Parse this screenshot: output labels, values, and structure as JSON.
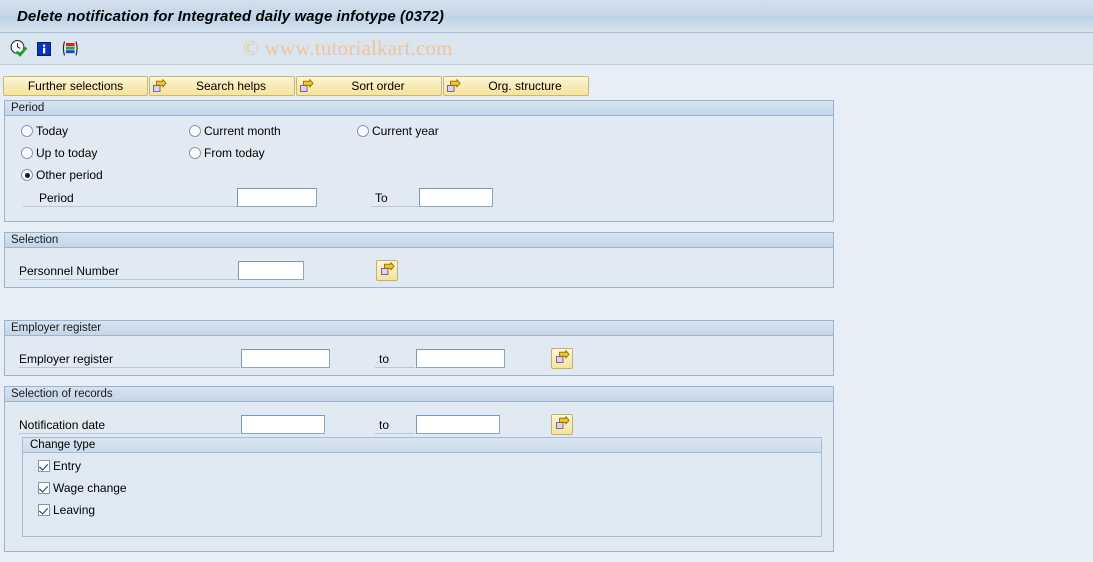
{
  "window": {
    "title": "Delete notification for Integrated daily wage infotype (0372)"
  },
  "watermark": {
    "text": "© www.tutorialkart.com"
  },
  "toolbar": {
    "icons": [
      {
        "name": "execute-clock-check-icon",
        "title": "Execute"
      },
      {
        "name": "information-icon",
        "title": "Information"
      },
      {
        "name": "variant-bars-icon",
        "title": "Get Variant"
      }
    ]
  },
  "buttons": [
    {
      "label": "Further selections",
      "icon": null
    },
    {
      "label": "Search helps",
      "icon": "arrow-right-icon"
    },
    {
      "label": "Sort order",
      "icon": "arrow-right-icon"
    },
    {
      "label": "Org. structure",
      "icon": "arrow-right-icon"
    }
  ],
  "period_panel": {
    "title": "Period",
    "radios": [
      {
        "label": "Today",
        "selected": false
      },
      {
        "label": "Current month",
        "selected": false
      },
      {
        "label": "Current year",
        "selected": false
      },
      {
        "label": "Up to today",
        "selected": false
      },
      {
        "label": "From today",
        "selected": false
      },
      {
        "label": "Other period",
        "selected": true
      }
    ],
    "period_label": "Period",
    "period_value": "",
    "to_label": "To",
    "to_value": ""
  },
  "selection_panel": {
    "title": "Selection",
    "personnel_number_label": "Personnel Number",
    "personnel_number_value": "",
    "multi_select_icon": "arrow-right-icon"
  },
  "employer_panel": {
    "title": "Employer register",
    "field_label": "Employer register",
    "from_value": "",
    "to_label": "to",
    "to_value": "",
    "multi_select_icon": "arrow-right-icon"
  },
  "records_panel": {
    "title": "Selection of records",
    "notification_date_label": "Notification date",
    "from_value": "",
    "to_label": "to",
    "to_value": "",
    "multi_select_icon": "arrow-right-icon",
    "change_type": {
      "title": "Change type",
      "items": [
        {
          "label": "Entry",
          "checked": true
        },
        {
          "label": "Wage change",
          "checked": true
        },
        {
          "label": "Leaving",
          "checked": true
        }
      ]
    }
  },
  "colors": {
    "background": "#e8eef5",
    "panel_bg": "#e1eaf3",
    "panel_border": "#9ab4cd",
    "title_gradient_top": "#d3e0ee",
    "button_yellow": "#f8eab4",
    "watermark": "#f0c49a",
    "accent_arrow": "#f5c518"
  }
}
